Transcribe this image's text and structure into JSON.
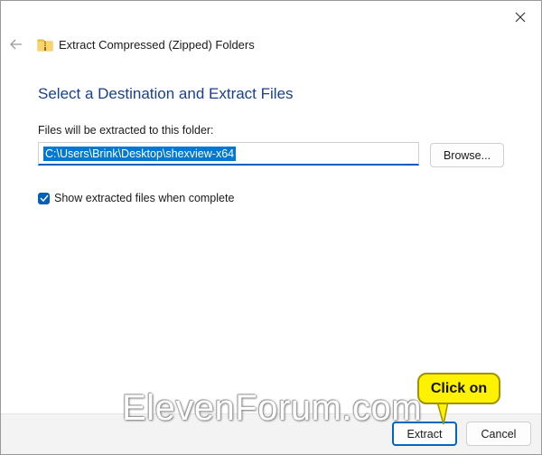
{
  "window": {
    "close_glyph": "✕"
  },
  "wizard": {
    "title": "Extract Compressed (Zipped) Folders",
    "back_icon": "back-arrow-icon",
    "folder_icon": "zip-folder-icon"
  },
  "main": {
    "heading": "Select a Destination and Extract Files",
    "field_label": "Files will be extracted to this folder:",
    "path_value": "C:\\Users\\Brink\\Desktop\\shexview-x64",
    "browse_label": "Browse...",
    "checkbox_label": "Show extracted files when complete",
    "checkbox_checked": true
  },
  "footer": {
    "extract_label": "Extract",
    "cancel_label": "Cancel"
  },
  "annotation": {
    "callout": "Click on",
    "watermark": "ElevenForum.com"
  },
  "colors": {
    "accent": "#0067c0",
    "heading": "#1a3f8f",
    "callout": "#fff200",
    "selection": "#0078d4"
  }
}
